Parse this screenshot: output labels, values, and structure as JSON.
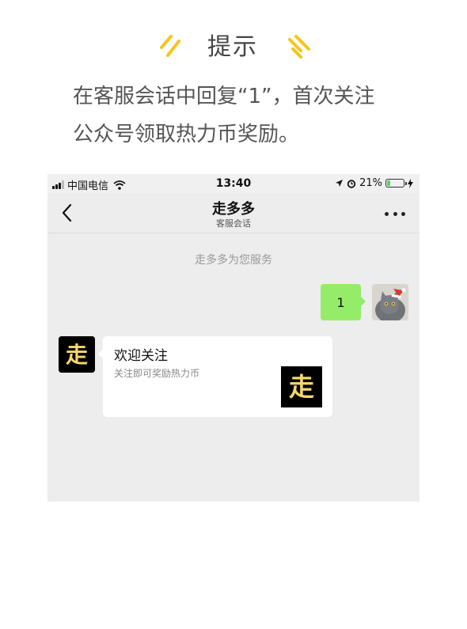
{
  "tip": {
    "title": "提示",
    "line1": "在客服会话中回复“1”，首次关注",
    "line2": "公众号领取热力币奖励。",
    "decor_icon": "sparkle-lines-icon",
    "accent_color": "#f5c518"
  },
  "status_bar": {
    "carrier": "中国电信",
    "time": "13:40",
    "battery_percent": "21%",
    "battery_level": 0.21,
    "icons": [
      "signal-icon",
      "wifi-icon",
      "location-icon",
      "alarm-icon",
      "battery-icon",
      "charging-icon"
    ]
  },
  "nav": {
    "title": "走多多",
    "subtitle": "客服会话",
    "back_icon": "chevron-left-icon",
    "more_icon": "more-dots-icon"
  },
  "chat": {
    "system_message": "走多多为您服务",
    "my_message": "1",
    "my_bubble_color": "#95ec69",
    "card": {
      "title": "欢迎关注",
      "description": "关注即可奖励热力币",
      "logo_glyph": "走"
    },
    "oa_logo_glyph": "走",
    "logo_color": "#f5d76e"
  }
}
